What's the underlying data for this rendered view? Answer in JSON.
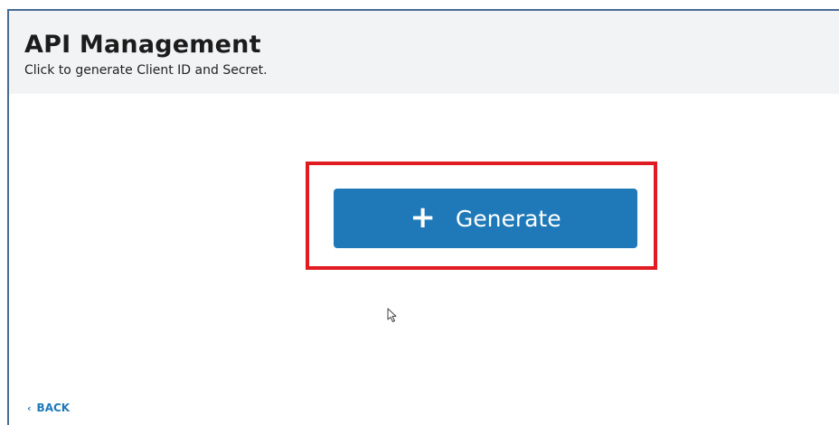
{
  "header": {
    "title": "API Management",
    "subtitle": "Click to generate Client ID and Secret."
  },
  "main": {
    "generate_button": {
      "icon": "plus-icon",
      "icon_glyph": "+",
      "label": "Generate"
    },
    "highlight_color": "#e01b22",
    "button_color": "#1f79b8"
  },
  "footer": {
    "back_icon": "chevron-left-icon",
    "back_icon_glyph": "‹",
    "back_label": "BACK"
  }
}
